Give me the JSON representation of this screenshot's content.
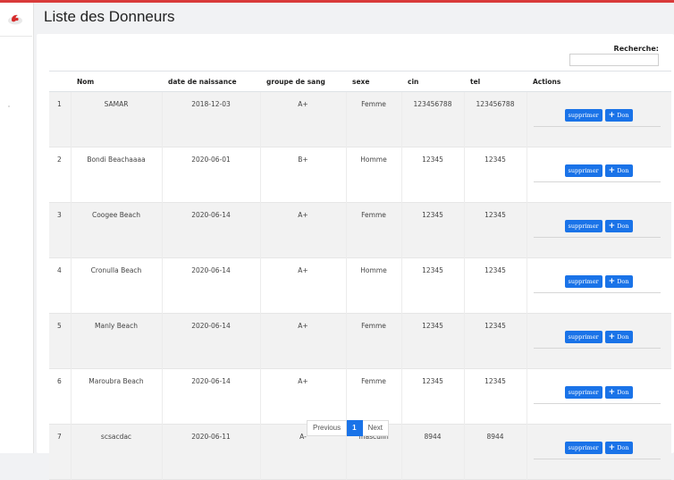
{
  "page": {
    "title": "Liste des Donneurs"
  },
  "search": {
    "label": "Recherche:",
    "value": ""
  },
  "table": {
    "headers": [
      "",
      "Nom",
      "date de naissance",
      "groupe de sang",
      "sexe",
      "cin",
      "tel",
      "Actions"
    ],
    "rows": [
      {
        "num": "1",
        "nom": "SAMAR",
        "date": "2018-12-03",
        "groupe": "A+",
        "sexe": "Femme",
        "cin": "123456788",
        "tel": "123456788"
      },
      {
        "num": "2",
        "nom": "Bondi Beachaaaa",
        "date": "2020-06-01",
        "groupe": "B+",
        "sexe": "Homme",
        "cin": "12345",
        "tel": "12345"
      },
      {
        "num": "3",
        "nom": "Coogee Beach",
        "date": "2020-06-14",
        "groupe": "A+",
        "sexe": "Femme",
        "cin": "12345",
        "tel": "12345"
      },
      {
        "num": "4",
        "nom": "Cronulla Beach",
        "date": "2020-06-14",
        "groupe": "A+",
        "sexe": "Homme",
        "cin": "12345",
        "tel": "12345"
      },
      {
        "num": "5",
        "nom": "Manly Beach",
        "date": "2020-06-14",
        "groupe": "A+",
        "sexe": "Femme",
        "cin": "12345",
        "tel": "12345"
      },
      {
        "num": "6",
        "nom": "Maroubra Beach",
        "date": "2020-06-14",
        "groupe": "A+",
        "sexe": "Femme",
        "cin": "12345",
        "tel": "12345"
      },
      {
        "num": "7",
        "nom": "scsacdac",
        "date": "2020-06-11",
        "groupe": "A-",
        "sexe": "masculin",
        "cin": "8944",
        "tel": "8944"
      }
    ]
  },
  "actions": {
    "delete_label": "supprimer",
    "don_label": "Don",
    "don_icon": "plus-icon"
  },
  "pagination": {
    "previous": "Previous",
    "current": "1",
    "next": "Next"
  },
  "colors": {
    "accent": "#1a73e8",
    "topline": "#d93a3a"
  }
}
